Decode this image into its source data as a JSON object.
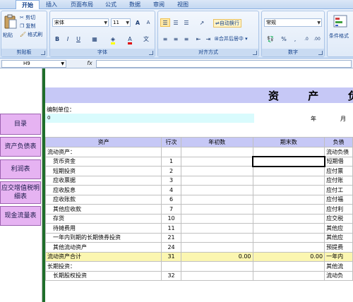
{
  "ribbon_tabs": [
    "开始",
    "插入",
    "页面布局",
    "公式",
    "数据",
    "审阅",
    "视图"
  ],
  "clipboard": {
    "paste_label": "粘贴",
    "cut_label": "剪切",
    "copy_label": "复制",
    "format_painter_label": "格式刷",
    "group_title": "剪贴板"
  },
  "font": {
    "font_name": "宋体",
    "font_size": "11",
    "group_title": "字体",
    "bold": "B",
    "italic": "I",
    "underline": "U",
    "grow": "A",
    "shrink": "A"
  },
  "alignment": {
    "wrap_label": "自动换行",
    "merge_label": "合并后居中",
    "group_title": "对齐方式"
  },
  "number": {
    "format": "常规",
    "group_title": "数字",
    "percent": "%",
    "comma": ","
  },
  "styles": {
    "conditional_label": "条件格式"
  },
  "formula_bar": {
    "cell_ref": "H9",
    "fx": "fx",
    "formula": ""
  },
  "nav_buttons": [
    "目录",
    "资产负债表",
    "利润表",
    "应交增值税明细表",
    "现金流量表"
  ],
  "sheet": {
    "title": "资 产 负",
    "unit_label": "编制单位：",
    "unit_value": "0",
    "year_label": "年",
    "month_label": "月",
    "headers": [
      "资产",
      "行次",
      "年初数",
      "期末数",
      "负债"
    ],
    "rows": [
      {
        "name": "流动资产：",
        "line": "",
        "start": "",
        "end": "",
        "right": "流动负债",
        "indent": false
      },
      {
        "name": "货币资金",
        "line": "1",
        "start": "",
        "end": "",
        "right": "短期借",
        "indent": true
      },
      {
        "name": "短期投资",
        "line": "2",
        "start": "",
        "end": "",
        "right": "应付票",
        "indent": true
      },
      {
        "name": "应收票据",
        "line": "3",
        "start": "",
        "end": "",
        "right": "应付账",
        "indent": true
      },
      {
        "name": "应收股息",
        "line": "4",
        "start": "",
        "end": "",
        "right": "应付工",
        "indent": true
      },
      {
        "name": "应收账款",
        "line": "6",
        "start": "",
        "end": "",
        "right": "应付福",
        "indent": true
      },
      {
        "name": "其他应收款",
        "line": "7",
        "start": "",
        "end": "",
        "right": "应付利",
        "indent": true
      },
      {
        "name": "存货",
        "line": "10",
        "start": "",
        "end": "",
        "right": "应交税",
        "indent": true
      },
      {
        "name": "待摊费用",
        "line": "11",
        "start": "",
        "end": "",
        "right": "其他应",
        "indent": true
      },
      {
        "name": "一年内到期的长期债券投资",
        "line": "21",
        "start": "",
        "end": "",
        "right": "其他应",
        "indent": true
      },
      {
        "name": "其他流动资产",
        "line": "24",
        "start": "",
        "end": "",
        "right": "预提费",
        "indent": true
      },
      {
        "name": "流动资产合计",
        "line": "31",
        "start": "0.00",
        "end": "0.00",
        "right": "一年内",
        "indent": false,
        "total": true
      },
      {
        "name": "长期投资：",
        "line": "",
        "start": "",
        "end": "",
        "right": "其他流",
        "indent": false
      },
      {
        "name": "长期股权投资",
        "line": "32",
        "start": "",
        "end": "",
        "right": "流动负",
        "indent": true
      }
    ]
  }
}
